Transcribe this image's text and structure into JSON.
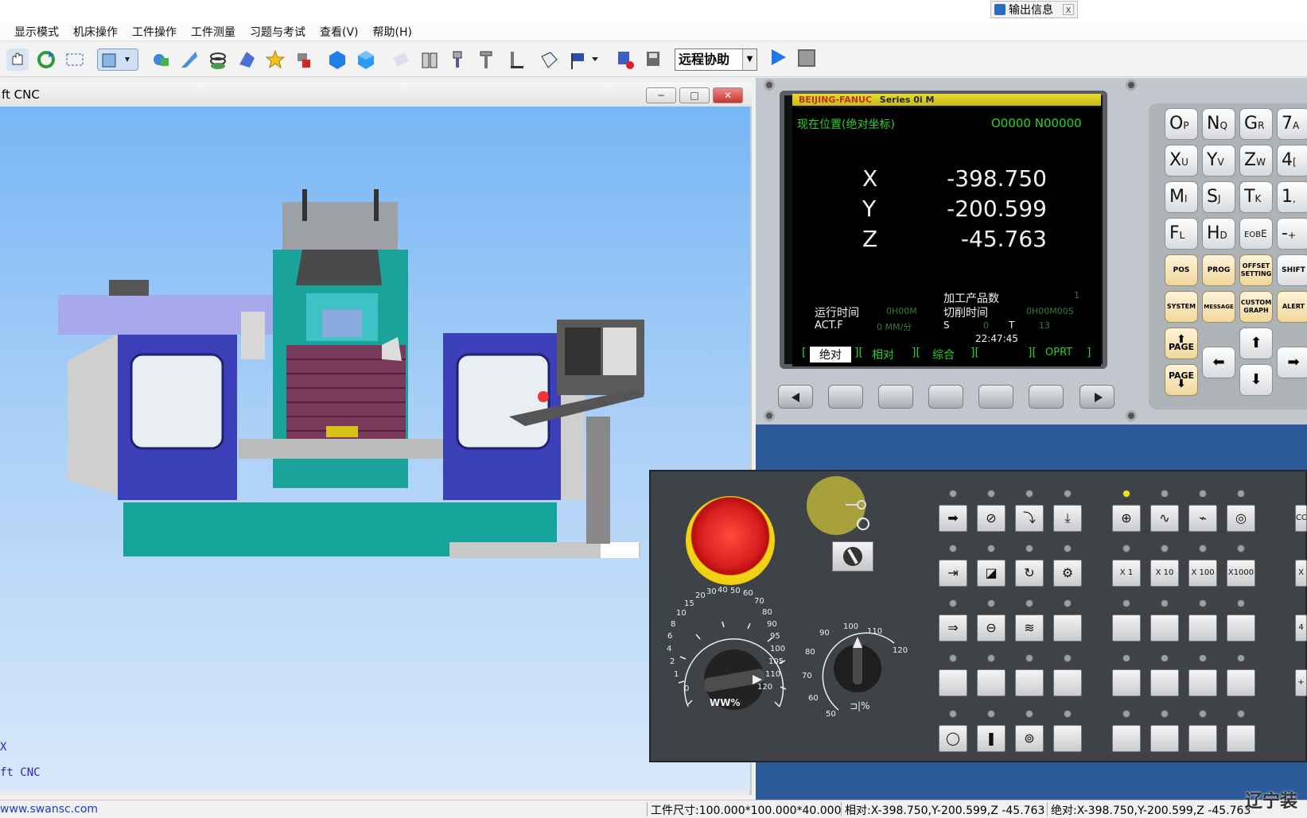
{
  "top": {
    "output_tab": "输出信息",
    "output_close": "x"
  },
  "menu": [
    "显示模式",
    "机床操作",
    "工件操作",
    "工件测量",
    "习题与考试",
    "查看(V)",
    "帮助(H)"
  ],
  "toolbar": {
    "combo_value": "远程协助",
    "icons": [
      "pan-icon",
      "refresh-icon",
      "select-icon",
      "view-icon",
      "measure-icon",
      "cut-icon",
      "coil-icon",
      "part-icon",
      "star-icon",
      "tool-icon",
      "cube-blue-icon",
      "cube-blue2-icon",
      "eraser-icon",
      "fixture-icon",
      "spindle-icon",
      "tool-height-icon",
      "tool-length-icon",
      "stock-icon",
      "flag-icon",
      "save-icon",
      "save-as-icon"
    ]
  },
  "cnc_window": {
    "title": "ft CNC",
    "btn_min": "─",
    "btn_max": "□",
    "btn_close": "✕",
    "view_text1": "X",
    "view_text2": "ft CNC"
  },
  "cnc_screen": {
    "brand": "BEIJING-FANUC",
    "series": "Series 0i M",
    "mode_title": "现在位置(绝对坐标)",
    "program": "O0000  N00000",
    "axes": [
      {
        "name": "X",
        "value": "-398.750"
      },
      {
        "name": "Y",
        "value": "-200.599"
      },
      {
        "name": "Z",
        "value": "-45.763"
      }
    ],
    "run_time_label": "运行时间",
    "run_time_value": "0H00M",
    "parts_label": "加工产品数",
    "parts_value": "1",
    "cut_time_label": "切削时间",
    "cut_time_value": "0H00M00S",
    "actf_label": "ACT.F",
    "actf_value": "0 MM/分",
    "s_label": "S",
    "s_value": "0",
    "t_label": "T",
    "t_value": "13",
    "clock": "22:47:45",
    "softkeys": [
      "绝对",
      "相对",
      "综合",
      "",
      "OPRT"
    ]
  },
  "keypad": {
    "address_keys": [
      [
        "O",
        "P"
      ],
      [
        "N",
        "Q"
      ],
      [
        "G",
        "R"
      ],
      [
        "7",
        "A"
      ],
      [
        "X",
        "U"
      ],
      [
        "Y",
        "V"
      ],
      [
        "Z",
        "W"
      ],
      [
        "4",
        "["
      ],
      [
        "M",
        "I"
      ],
      [
        "S",
        "J"
      ],
      [
        "T",
        "K"
      ],
      [
        "1",
        ","
      ],
      [
        "F",
        "L"
      ],
      [
        "H",
        "D"
      ],
      [
        "EOB",
        "E"
      ],
      [
        "-",
        "+"
      ]
    ],
    "function_keys": [
      "POS",
      "PROG",
      "OFFSET SETTING",
      "SHIFT",
      "SYSTEM",
      "MESSAGE",
      "CUSTOM GRAPH",
      "ALERT"
    ],
    "page_up": "PAGE",
    "page_down": "PAGE"
  },
  "op_panel": {
    "feed_ticks": [
      "0",
      "1",
      "2",
      "4",
      "6",
      "8",
      "10",
      "15",
      "20",
      "30",
      "40",
      "50",
      "60",
      "70",
      "80",
      "90",
      "95",
      "100",
      "105",
      "110",
      "120"
    ],
    "spindle_ticks": [
      "50",
      "60",
      "70",
      "80",
      "90",
      "100",
      "110",
      "120"
    ],
    "feed_label": "WW%",
    "spindle_label": "%",
    "multipliers": [
      "X 1",
      "X 10",
      "X 100",
      "X1000"
    ],
    "right_edge": [
      "CO",
      "X",
      "4",
      "+"
    ]
  },
  "status": {
    "url": "www.swansc.com",
    "size": "工件尺寸:100.000*100.000*40.000",
    "relative": "相对:X-398.750,Y-200.599,Z -45.763",
    "absolute": "绝对:X-398.750,Y-200.599,Z -45.763",
    "watermark": "辽宁装"
  },
  "colors": {
    "screen_green": "#2ad12a",
    "panel_blue": "#2c5a98",
    "title_yellow": "#e8dc2a",
    "estop_red": "#d81f1f"
  }
}
